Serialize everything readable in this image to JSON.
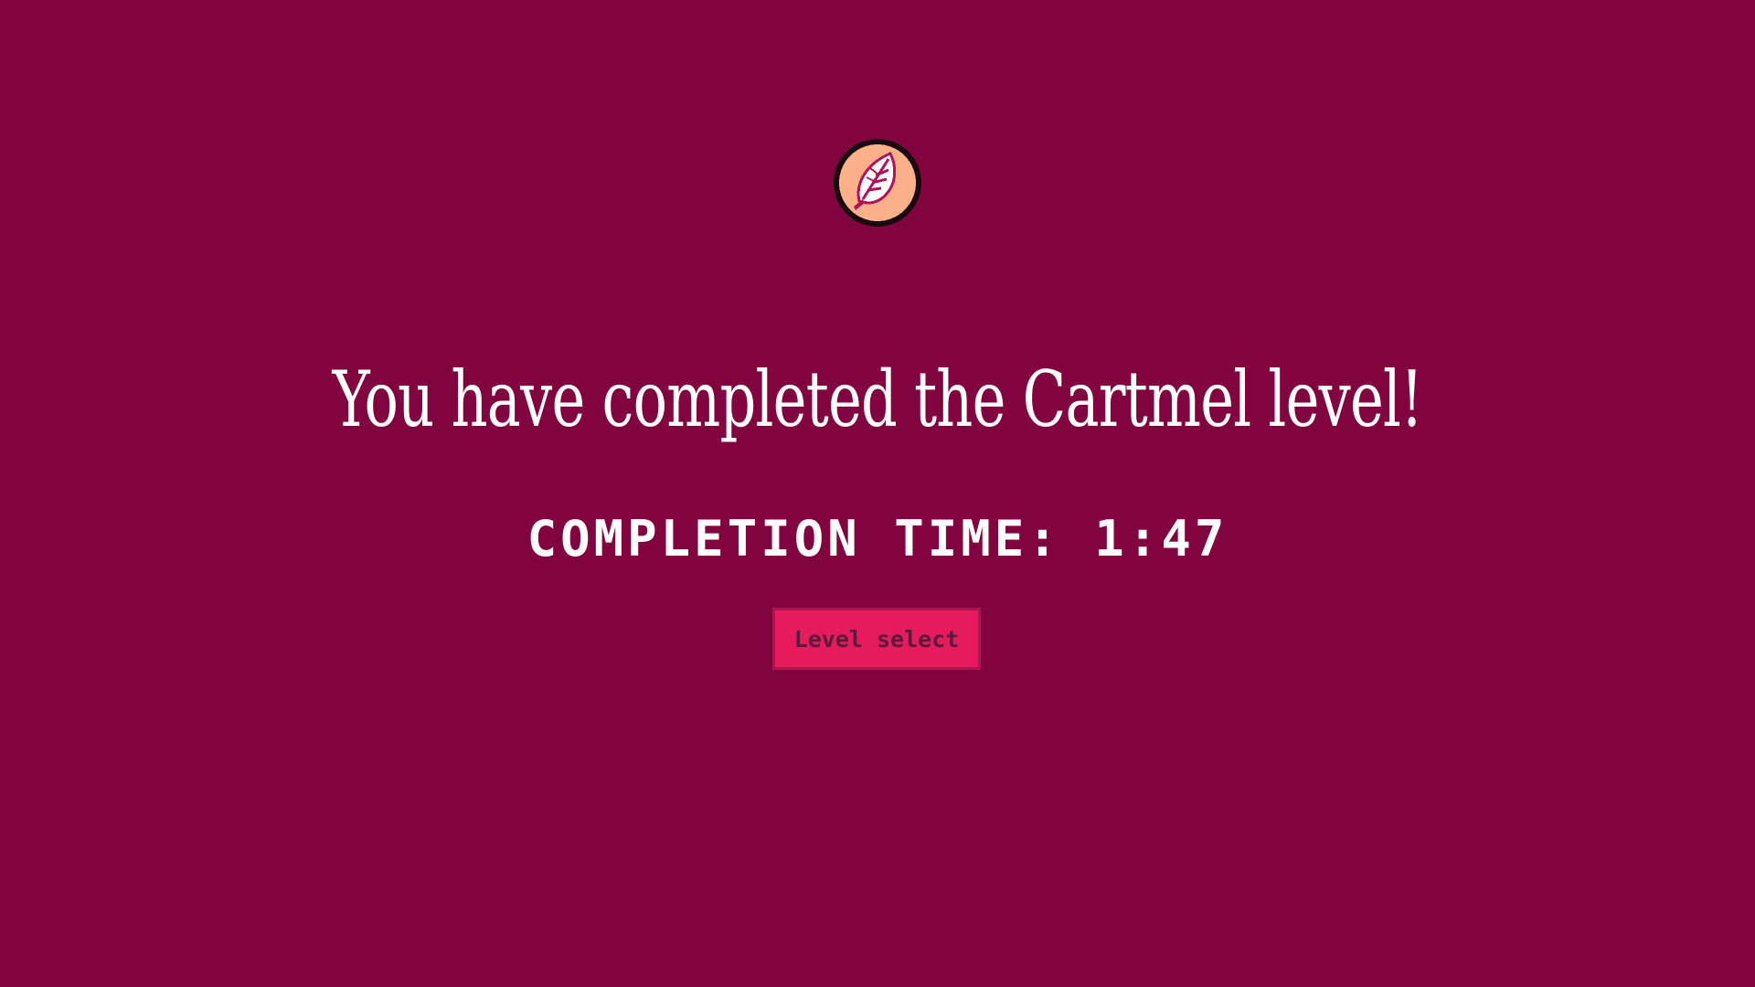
{
  "colors": {
    "background": "#82043e",
    "button_bg": "#e51b5e",
    "button_border": "#b0144f",
    "button_text": "#5a1a3a",
    "badge_fill": "#fbb08a",
    "badge_outline": "#1a0a10",
    "leaf_fill": "#ffffff",
    "leaf_detail": "#b31258"
  },
  "badge": {
    "icon": "leaf-medal-icon"
  },
  "title": "You have completed the Cartmel level!",
  "completion_time": "COMPLETION TIME: 1:47",
  "level_select_button": "Level select"
}
